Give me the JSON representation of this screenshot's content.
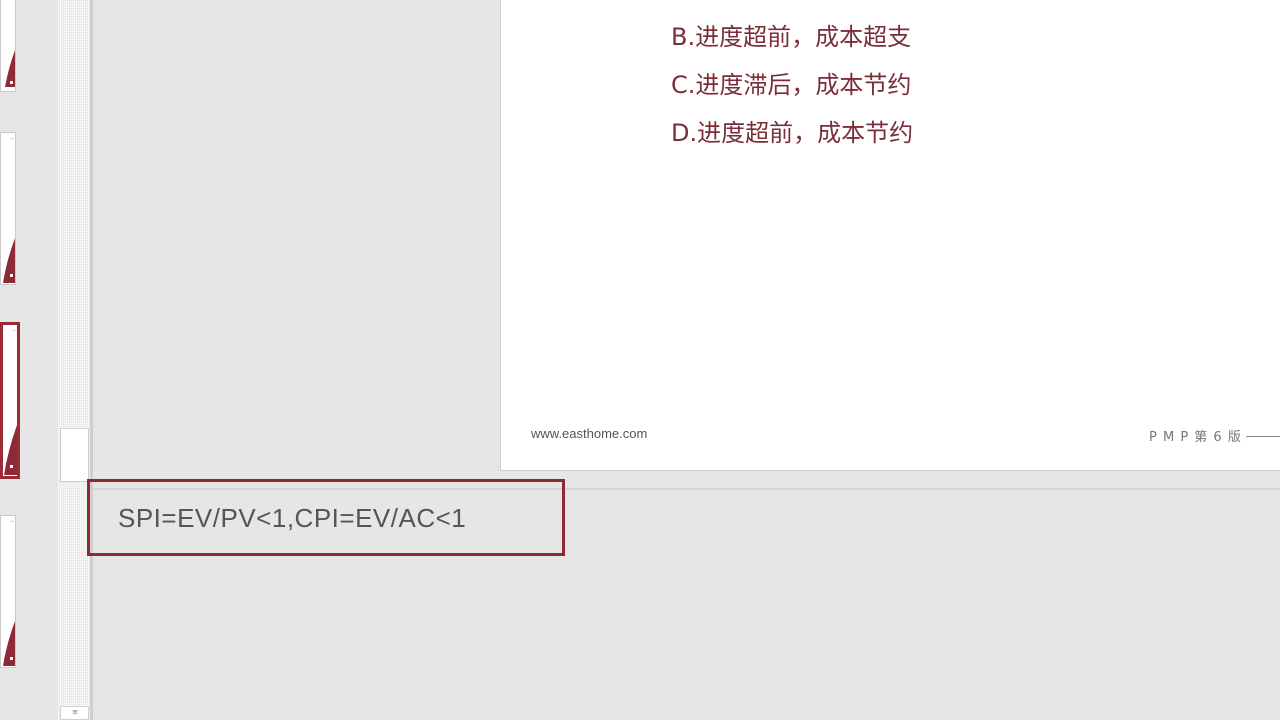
{
  "thumbnails": [
    {
      "id": "thumb-1",
      "selected": false
    },
    {
      "id": "thumb-2",
      "selected": false
    },
    {
      "id": "thumb-3",
      "selected": true
    },
    {
      "id": "thumb-4",
      "selected": false
    }
  ],
  "slide": {
    "options": [
      "B.进度超前，成本超支",
      "C.进度滞后，成本节约",
      "D.进度超前，成本节约"
    ],
    "footer_url": "www.easthome.com",
    "footer_right": "P M P 第 6 版"
  },
  "notes": {
    "text": "SPI=EV/PV<1,CPI=EV/AC<1"
  },
  "colors": {
    "option_text": "#7a2e37",
    "selection_border": "#8e2a35",
    "background": "#e6e6e6"
  }
}
